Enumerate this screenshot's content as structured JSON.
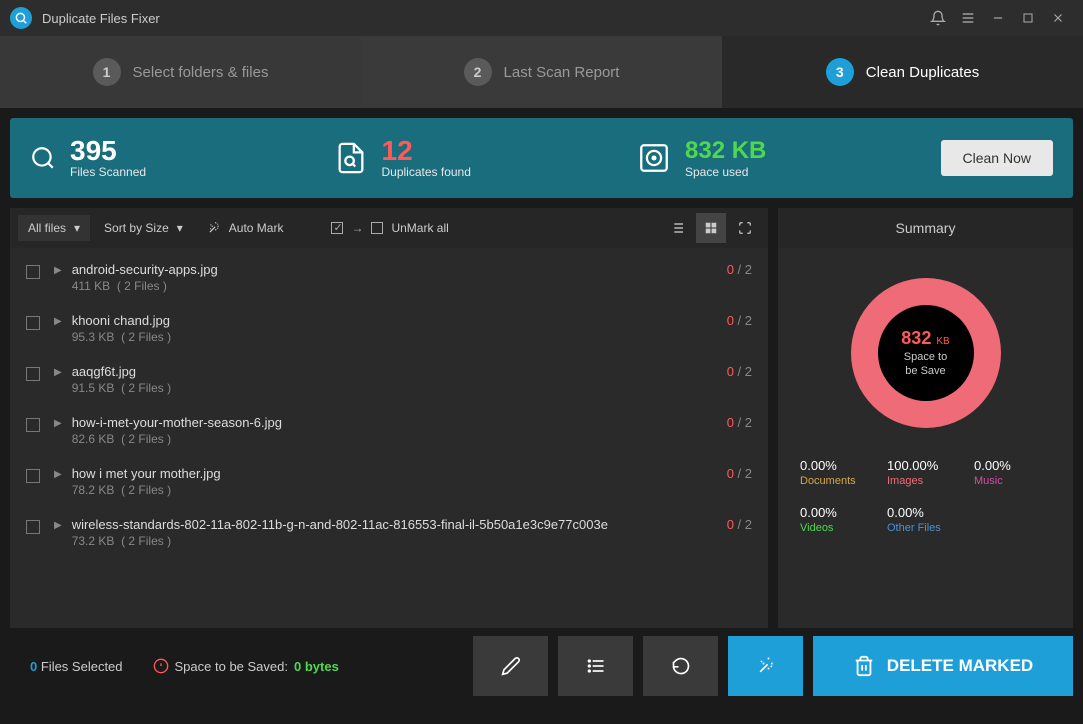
{
  "app": {
    "title": "Duplicate Files Fixer"
  },
  "steps": [
    {
      "num": "1",
      "label": "Select folders & files"
    },
    {
      "num": "2",
      "label": "Last Scan Report"
    },
    {
      "num": "3",
      "label": "Clean Duplicates"
    }
  ],
  "stats": {
    "scanned": {
      "value": "395",
      "label": "Files Scanned"
    },
    "duplicates": {
      "value": "12",
      "label": "Duplicates found"
    },
    "space": {
      "value": "832 KB",
      "label": "Space used"
    },
    "clean_btn": "Clean Now"
  },
  "toolbar": {
    "filter": "All files",
    "sort": "Sort by Size",
    "automark": "Auto Mark",
    "unmark": "UnMark all"
  },
  "files": [
    {
      "name": "android-security-apps.jpg",
      "size": "411 KB",
      "files": "( 2 Files )",
      "marked": "0",
      "total": "2"
    },
    {
      "name": "khooni chand.jpg",
      "size": "95.3 KB",
      "files": "( 2 Files )",
      "marked": "0",
      "total": "2"
    },
    {
      "name": "aaqgf6t.jpg",
      "size": "91.5 KB",
      "files": "( 2 Files )",
      "marked": "0",
      "total": "2"
    },
    {
      "name": "how-i-met-your-mother-season-6.jpg",
      "size": "82.6 KB",
      "files": "( 2 Files )",
      "marked": "0",
      "total": "2"
    },
    {
      "name": "how i met your mother.jpg",
      "size": "78.2 KB",
      "files": "( 2 Files )",
      "marked": "0",
      "total": "2"
    },
    {
      "name": "wireless-standards-802-11a-802-11b-g-n-and-802-11ac-816553-final-il-5b50a1e3c9e77c003e",
      "size": "73.2 KB",
      "files": "( 2 Files )",
      "marked": "0",
      "total": "2"
    }
  ],
  "summary": {
    "title": "Summary",
    "donut": {
      "value": "832",
      "unit": "KB",
      "label1": "Space to",
      "label2": "be Save"
    },
    "cats": [
      {
        "pct": "0.00%",
        "name": "Documents",
        "color": "#d4a847"
      },
      {
        "pct": "100.00%",
        "name": "Images",
        "color": "#f06b78"
      },
      {
        "pct": "0.00%",
        "name": "Music",
        "color": "#d44da0"
      },
      {
        "pct": "0.00%",
        "name": "Videos",
        "color": "#4fd84f"
      },
      {
        "pct": "0.00%",
        "name": "Other Files",
        "color": "#4a90d8"
      }
    ]
  },
  "footer": {
    "selected_num": "0",
    "selected_lbl": "Files Selected",
    "saved_lbl": "Space to be Saved:",
    "saved_val": "0 bytes",
    "delete": "DELETE MARKED"
  }
}
